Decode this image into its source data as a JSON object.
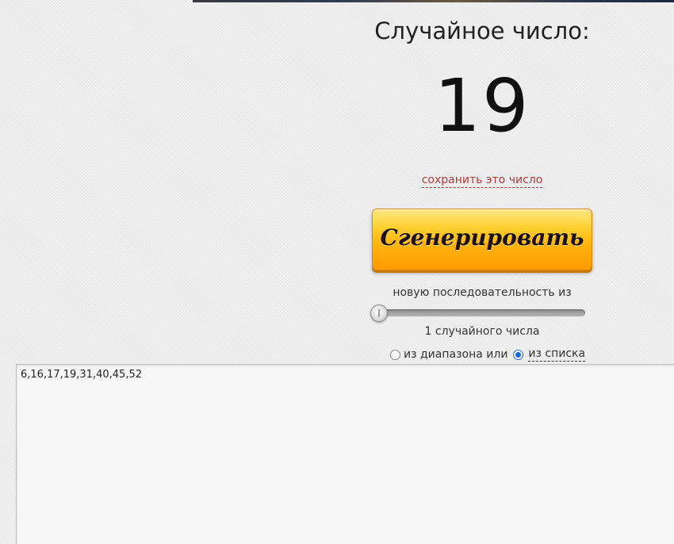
{
  "header": {
    "title": "Случайное число:"
  },
  "result": {
    "value": "19",
    "save_link": "сохранить это число"
  },
  "controls": {
    "generate_label": "Сгенерировать",
    "sequence_label": "новую последовательность из",
    "slider_value": 1,
    "count_label": "1 случайного числа",
    "mode": {
      "range_label": "из диапазона или",
      "list_label": "из списка",
      "selected": "list"
    }
  },
  "list_input": {
    "value": "6,16,17,19,31,40,45,52"
  },
  "colors": {
    "button_gradient_top": "#ffe985",
    "button_gradient_bottom": "#ff9a06",
    "save_link": "#b23a3a",
    "radio_selected": "#1a66e0"
  }
}
